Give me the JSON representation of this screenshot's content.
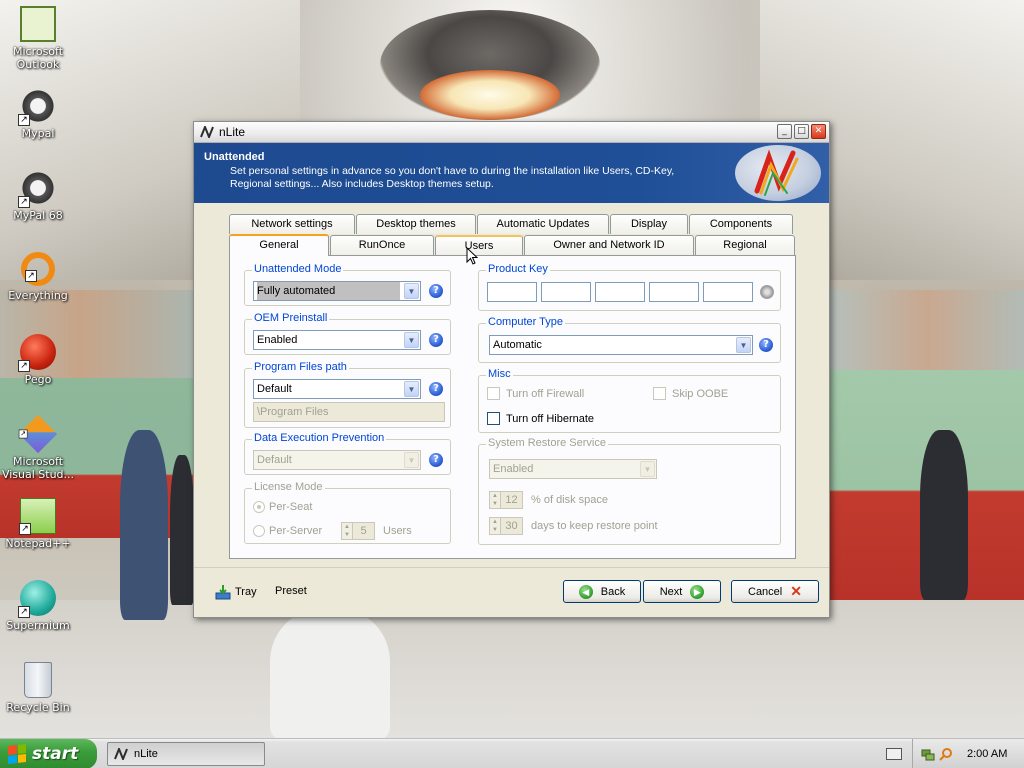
{
  "desktop": {
    "icons": [
      {
        "label": "Microsoft Outlook",
        "icon": "outlook-icon"
      },
      {
        "label": "Mypal",
        "icon": "mypal-icon"
      },
      {
        "label": "MyPal 68",
        "icon": "mypal-icon"
      },
      {
        "label": "Everything",
        "icon": "everything-icon"
      },
      {
        "label": "Pego",
        "icon": "pego-icon"
      },
      {
        "label": "Microsoft Visual Stud...",
        "icon": "visual-studio-icon"
      },
      {
        "label": "Notepad++",
        "icon": "notepad-plus-plus-icon"
      },
      {
        "label": "Supermium",
        "icon": "supermium-icon"
      },
      {
        "label": "Recycle Bin",
        "icon": "recycle-bin-icon"
      }
    ]
  },
  "window": {
    "title": "nLite",
    "header_title": "Unattended",
    "header_desc": "Set personal settings in advance so you don't have to during the installation like Users, CD-Key, Regional settings... Also includes Desktop themes setup.",
    "tabs_back": [
      "Network settings",
      "Desktop themes",
      "Automatic Updates",
      "Display",
      "Components"
    ],
    "tabs_front": [
      "General",
      "RunOnce",
      "Users",
      "Owner and Network ID",
      "Regional"
    ],
    "active_tab": "General"
  },
  "general": {
    "unattended_mode": {
      "label": "Unattended Mode",
      "value": "Fully automated"
    },
    "oem_preinstall": {
      "label": "OEM Preinstall",
      "value": "Enabled"
    },
    "program_files": {
      "label": "Program Files path",
      "value": "Default",
      "path": "\\Program Files"
    },
    "dep": {
      "label": "Data Execution Prevention",
      "value": "Default"
    },
    "license_mode": {
      "label": "License Mode",
      "per_seat": "Per-Seat",
      "per_server": "Per-Server",
      "users_count": "5",
      "users_label": "Users"
    },
    "product_key": {
      "label": "Product Key"
    },
    "computer_type": {
      "label": "Computer Type",
      "value": "Automatic"
    },
    "misc": {
      "label": "Misc",
      "turn_off_firewall": "Turn off Firewall",
      "skip_oobe": "Skip OOBE",
      "turn_off_hibernate": "Turn off Hibernate"
    },
    "system_restore": {
      "label": "System Restore Service",
      "value": "Enabled",
      "disk_space": "12",
      "disk_space_label": "% of disk space",
      "days": "30",
      "days_label": "days to keep restore point"
    }
  },
  "footer": {
    "tray": "Tray",
    "preset": "Preset",
    "back": "Back",
    "next": "Next",
    "cancel": "Cancel"
  },
  "taskbar": {
    "start": "start",
    "task": "nLite",
    "clock": "2:00 AM"
  },
  "colors": {
    "header_bg": "#1f4f97",
    "group_label": "#0046d5",
    "active_tab_accent": "#f3a41c"
  }
}
